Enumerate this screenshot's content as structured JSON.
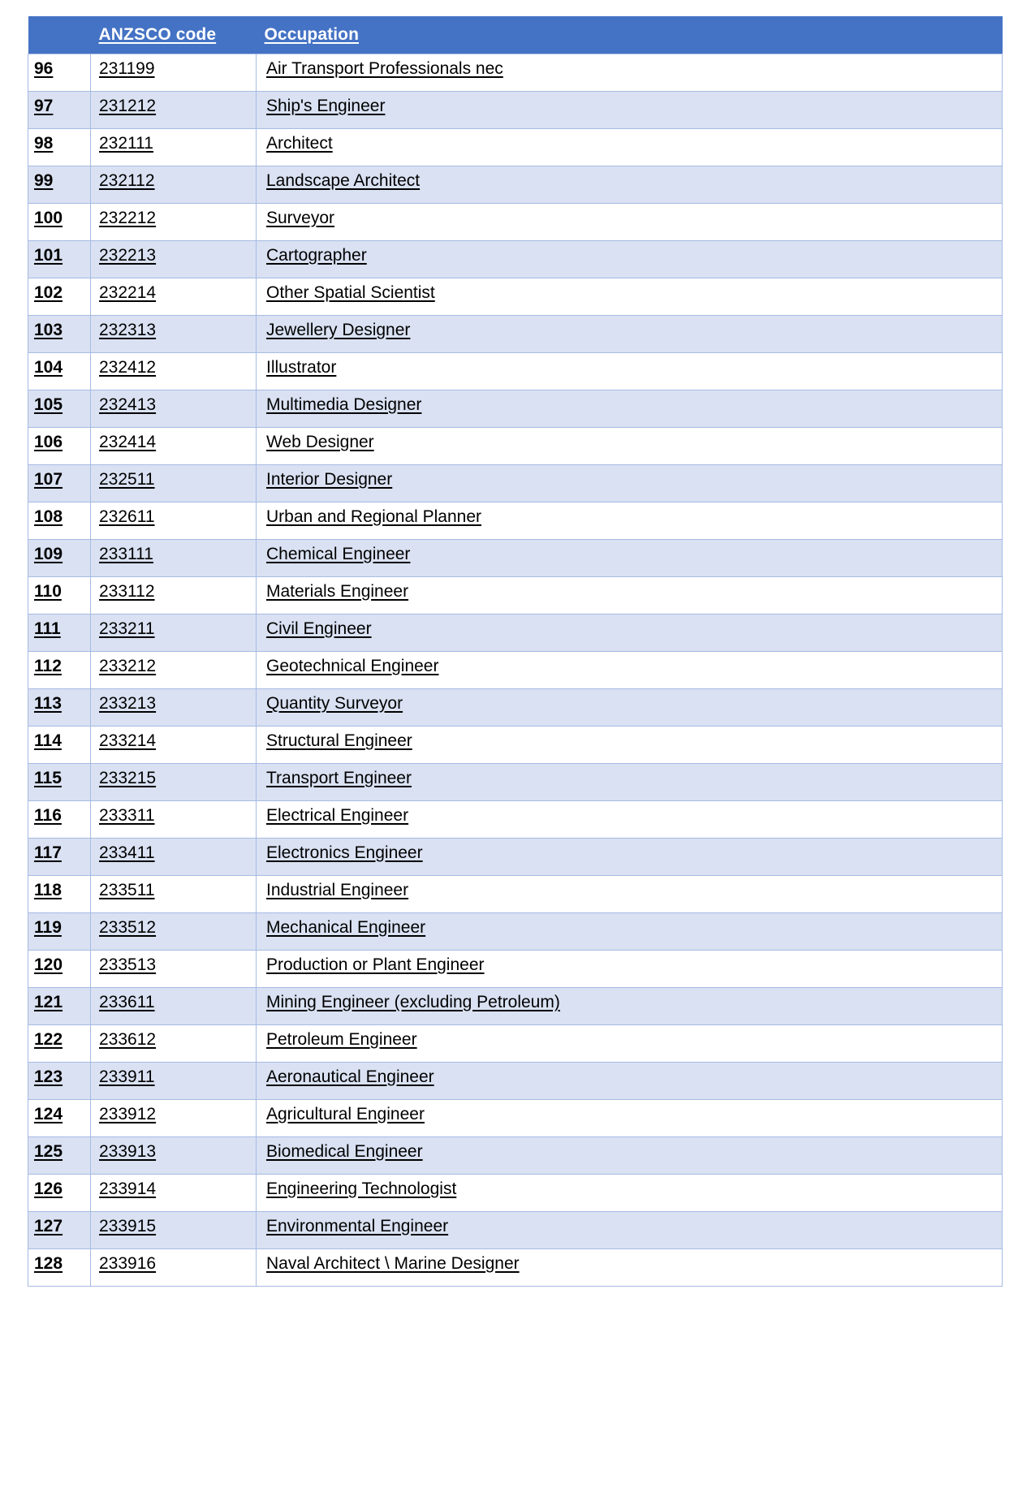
{
  "table": {
    "name": "ANZSCO skilled occupation list (rows 96-128)",
    "colors": {
      "header_background": "#4472C4",
      "header_text": "#FFFFFF",
      "band_row_background": "#D9E1F2",
      "plain_row_background": "#FFFFFF",
      "grid_line": "#A7BBE3",
      "cell_text": "#000000"
    },
    "columns": [
      {
        "key": "index",
        "label": ""
      },
      {
        "key": "code",
        "label": "ANZSCO code"
      },
      {
        "key": "occupation",
        "label": "Occupation"
      }
    ],
    "rows": [
      {
        "index": "96",
        "code": "231199",
        "occupation": "Air Transport Professionals nec"
      },
      {
        "index": "97",
        "code": "231212",
        "occupation": "Ship's Engineer"
      },
      {
        "index": "98",
        "code": "232111",
        "occupation": "Architect"
      },
      {
        "index": "99",
        "code": "232112",
        "occupation": "Landscape Architect"
      },
      {
        "index": "100",
        "code": "232212",
        "occupation": "Surveyor"
      },
      {
        "index": "101",
        "code": "232213",
        "occupation": "Cartographer"
      },
      {
        "index": "102",
        "code": "232214",
        "occupation": "Other Spatial Scientist"
      },
      {
        "index": "103",
        "code": "232313",
        "occupation": "Jewellery Designer"
      },
      {
        "index": "104",
        "code": "232412",
        "occupation": "Illustrator"
      },
      {
        "index": "105",
        "code": "232413",
        "occupation": "Multimedia Designer"
      },
      {
        "index": "106",
        "code": "232414",
        "occupation": "Web Designer"
      },
      {
        "index": "107",
        "code": "232511",
        "occupation": "Interior Designer"
      },
      {
        "index": "108",
        "code": "232611",
        "occupation": "Urban and Regional Planner"
      },
      {
        "index": "109",
        "code": "233111",
        "occupation": "Chemical Engineer"
      },
      {
        "index": "110",
        "code": "233112",
        "occupation": "Materials Engineer"
      },
      {
        "index": "111",
        "code": "233211",
        "occupation": "Civil Engineer"
      },
      {
        "index": "112",
        "code": "233212",
        "occupation": "Geotechnical Engineer"
      },
      {
        "index": "113",
        "code": "233213",
        "occupation": "Quantity Surveyor"
      },
      {
        "index": "114",
        "code": "233214",
        "occupation": "Structural Engineer"
      },
      {
        "index": "115",
        "code": "233215",
        "occupation": "Transport Engineer"
      },
      {
        "index": "116",
        "code": "233311",
        "occupation": "Electrical Engineer"
      },
      {
        "index": "117",
        "code": "233411",
        "occupation": "Electronics Engineer"
      },
      {
        "index": "118",
        "code": "233511",
        "occupation": "Industrial Engineer"
      },
      {
        "index": "119",
        "code": "233512",
        "occupation": "Mechanical Engineer"
      },
      {
        "index": "120",
        "code": "233513",
        "occupation": "Production or Plant Engineer"
      },
      {
        "index": "121",
        "code": "233611",
        "occupation": "Mining Engineer (excluding Petroleum)"
      },
      {
        "index": "122",
        "code": "233612",
        "occupation": "Petroleum Engineer"
      },
      {
        "index": "123",
        "code": "233911",
        "occupation": "Aeronautical Engineer"
      },
      {
        "index": "124",
        "code": "233912",
        "occupation": "Agricultural Engineer"
      },
      {
        "index": "125",
        "code": "233913",
        "occupation": "Biomedical Engineer"
      },
      {
        "index": "126",
        "code": "233914",
        "occupation": "Engineering Technologist"
      },
      {
        "index": "127",
        "code": "233915",
        "occupation": "Environmental Engineer"
      },
      {
        "index": "128",
        "code": "233916",
        "occupation": "Naval Architect \\ Marine Designer"
      }
    ]
  }
}
